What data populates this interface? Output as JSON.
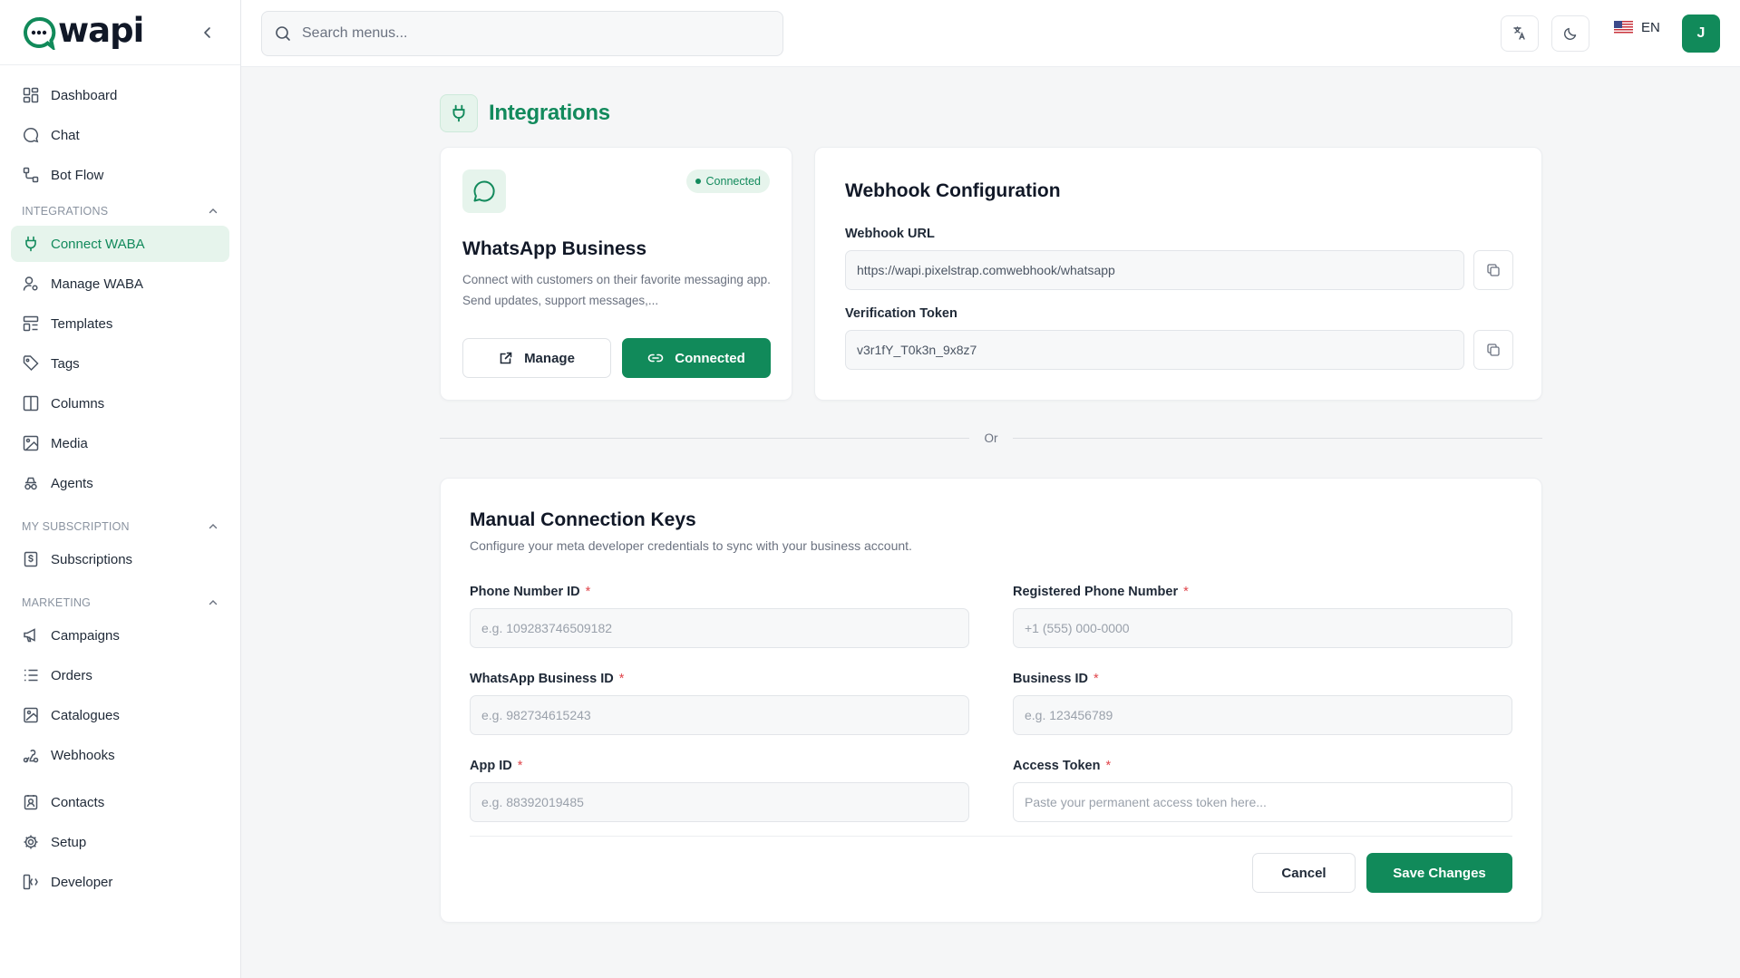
{
  "brand": {
    "name": "wapi",
    "accent": "#118a5a",
    "accent_light": "#e6f4ec"
  },
  "sidebar": {
    "top_items": [
      {
        "label": "Dashboard",
        "icon": "dashboard-icon"
      },
      {
        "label": "Chat",
        "icon": "chat-icon"
      },
      {
        "label": "Bot Flow",
        "icon": "flow-icon"
      }
    ],
    "sections": {
      "integrations": {
        "title": "INTEGRATIONS",
        "items": [
          "Connect WABA",
          "Manage WABA",
          "Templates",
          "Tags",
          "Columns",
          "Media",
          "Agents"
        ]
      },
      "subscription": {
        "title": "MY SUBSCRIPTION",
        "items": [
          "Subscriptions"
        ]
      },
      "marketing": {
        "title": "MARKETING",
        "items": [
          "Campaigns",
          "Orders",
          "Catalogues",
          "Webhooks"
        ]
      }
    },
    "bottom_items": [
      "Contacts",
      "Setup",
      "Developer"
    ]
  },
  "topbar": {
    "search_placeholder": "Search menus...",
    "language": "EN",
    "avatar_initial": "J"
  },
  "page": {
    "title": "Integrations"
  },
  "whatsapp_card": {
    "status": "Connected",
    "title": "WhatsApp Business",
    "description": "Connect with customers on their favorite messaging app. Send updates, support messages,...",
    "manage_label": "Manage",
    "connected_label": "Connected"
  },
  "webhook": {
    "title": "Webhook Configuration",
    "url_label": "Webhook URL",
    "url_value": "https://wapi.pixelstrap.comwebhook/whatsapp",
    "token_label": "Verification Token",
    "token_value": "v3r1fY_T0k3n_9x8z7"
  },
  "divider_text": "Or",
  "manual": {
    "title": "Manual Connection Keys",
    "subtitle": "Configure your meta developer credentials to sync with your business account.",
    "fields": {
      "phone_number_id": {
        "label": "Phone Number ID",
        "placeholder": "e.g. 109283746509182"
      },
      "registered_phone": {
        "label": "Registered Phone Number",
        "placeholder": "+1 (555) 000-0000"
      },
      "whatsapp_business_id": {
        "label": "WhatsApp Business ID",
        "placeholder": "e.g. 982734615243"
      },
      "business_id": {
        "label": "Business ID",
        "placeholder": "e.g. 123456789"
      },
      "app_id": {
        "label": "App ID",
        "placeholder": "e.g. 88392019485"
      },
      "access_token": {
        "label": "Access Token",
        "placeholder": "Paste your permanent access token here..."
      }
    },
    "required_mark": "*",
    "cancel_label": "Cancel",
    "save_label": "Save Changes"
  }
}
